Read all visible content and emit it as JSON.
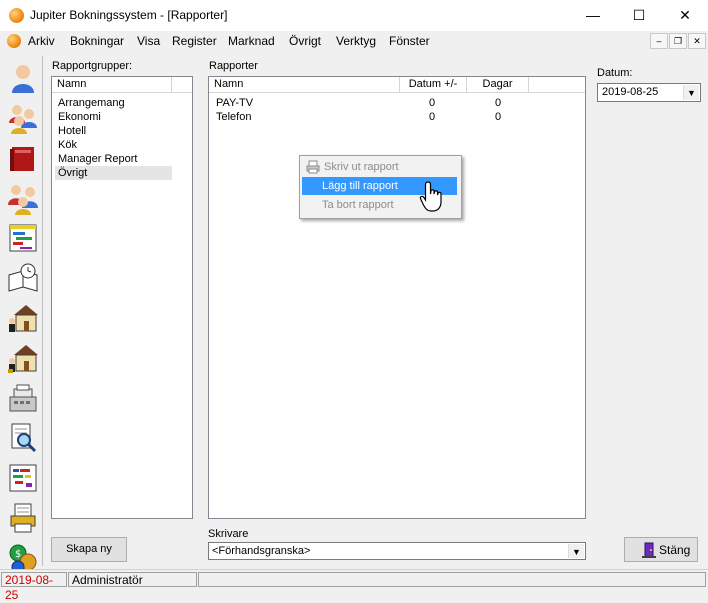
{
  "window": {
    "title": "Jupiter Bokningssystem - [Rapporter]",
    "minimize": "—",
    "maximize": "☐",
    "close": "✕"
  },
  "menu": {
    "items": [
      "Arkiv",
      "Bokningar",
      "Visa",
      "Register",
      "Marknad",
      "Övrigt",
      "Verktyg",
      "Fönster"
    ],
    "mdi": [
      "–",
      "❐",
      "✕"
    ]
  },
  "toolbar": {
    "icons": [
      "person-icon",
      "group-icon",
      "book-icon",
      "people-icon",
      "calendar-chart-icon",
      "book-clock-icon",
      "house-arrive-icon",
      "house-depart-icon",
      "cash-register-icon",
      "document-search-icon",
      "color-chart-icon",
      "document-printer-icon",
      "money-icon"
    ]
  },
  "rapportgrupper": {
    "label": "Rapportgrupper:",
    "column": "Namn",
    "items": [
      "Arrangemang",
      "Ekonomi",
      "Hotell",
      "Kök",
      "Manager Report",
      "Övrigt"
    ],
    "selected_index": 5
  },
  "rapporter": {
    "label": "Rapporter",
    "columns": [
      "Namn",
      "Datum +/-",
      "Dagar"
    ],
    "rows": [
      {
        "namn": "PAY-TV",
        "datum": "0",
        "dagar": "0"
      },
      {
        "namn": "Telefon",
        "datum": "0",
        "dagar": "0"
      }
    ]
  },
  "context_menu": {
    "items": [
      {
        "label": "Skriv ut rapport",
        "enabled": false
      },
      {
        "label": "Lägg till rapport",
        "enabled": true,
        "highlighted": true
      },
      {
        "label": "Ta bort rapport",
        "enabled": false
      }
    ]
  },
  "datum": {
    "label": "Datum:",
    "value": "2019-08-25"
  },
  "skrivare": {
    "label": "Skrivare",
    "value": "<Förhandsgranska>"
  },
  "buttons": {
    "skapa_ny": "Skapa ny",
    "stang": "Stäng"
  },
  "status": {
    "date": "2019-08-25",
    "user": "Administratör"
  },
  "colors": {
    "highlight": "#3399ff",
    "status_date": "#cc0000"
  }
}
